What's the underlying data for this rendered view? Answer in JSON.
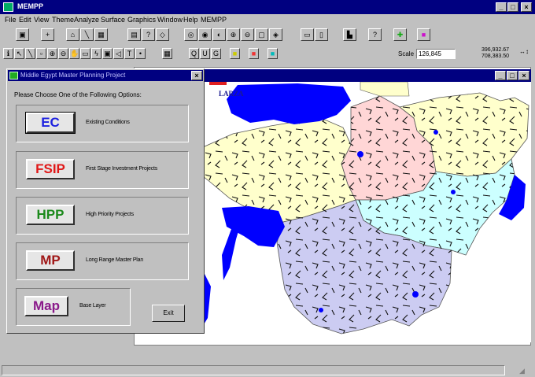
{
  "app": {
    "title": "MEMPP",
    "window_controls": [
      "_",
      "□",
      "×"
    ]
  },
  "menu": [
    "File",
    "Edit",
    "View",
    "Theme",
    "Analyze",
    "Surface",
    "Graphics",
    "Window",
    "Help",
    "MEMPP"
  ],
  "toolbar": {
    "scale_label": "Scale 1:",
    "scale_value": "126,845",
    "coords_x": "396,932.67",
    "coords_y": "708,383.50"
  },
  "map_window": {
    "label": "LARZA",
    "controls": [
      "_",
      "□",
      "×"
    ]
  },
  "dialog": {
    "title": "Middle Egypt Master Planning Project",
    "prompt": "Please Choose One of the Following Options:",
    "options": [
      {
        "code": "EC",
        "desc": "Existing Conditions",
        "color": "#1e22e0"
      },
      {
        "code": "FSIP",
        "desc": "First Stage Investment Projects",
        "color": "#e01818"
      },
      {
        "code": "HPP",
        "desc": "High Priority Projects",
        "color": "#1c8a1c"
      },
      {
        "code": "MP",
        "desc": "Long Range Master Plan",
        "color": "#a01818"
      },
      {
        "code": "Map",
        "desc": "Base Layer",
        "color": "#8a1a8a"
      }
    ],
    "exit_label": "Exit"
  },
  "colors": {
    "titlebar": "#000080",
    "water": "#0000ff",
    "region_yellow": "#ffffcc",
    "region_pink": "#ffd6d6",
    "region_cyan": "#ccffff",
    "region_lavender": "#ccccf2"
  }
}
